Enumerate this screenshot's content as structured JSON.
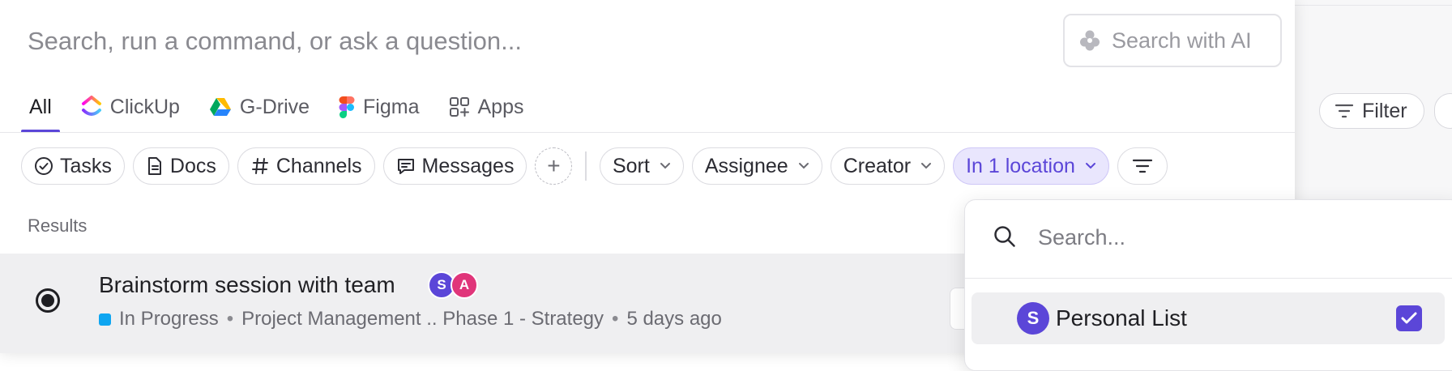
{
  "command_bar": {
    "placeholder": "Search, run a command, or ask a question...",
    "ai_button_label": "Search with AI"
  },
  "tabs": [
    {
      "label": "All",
      "active": true
    },
    {
      "label": "ClickUp",
      "icon": "clickup-logo-icon"
    },
    {
      "label": "G-Drive",
      "icon": "google-drive-icon"
    },
    {
      "label": "Figma",
      "icon": "figma-icon"
    },
    {
      "label": "Apps",
      "icon": "apps-grid-icon"
    }
  ],
  "filters": {
    "type_chips": [
      {
        "label": "Tasks",
        "icon": "check-circle-icon"
      },
      {
        "label": "Docs",
        "icon": "document-icon"
      },
      {
        "label": "Channels",
        "icon": "hash-icon"
      },
      {
        "label": "Messages",
        "icon": "message-icon"
      }
    ],
    "sort_label": "Sort",
    "assignee_label": "Assignee",
    "creator_label": "Creator",
    "location_label": "In 1 location"
  },
  "results": {
    "heading": "Results",
    "items": [
      {
        "title": "Brainstorm session with team",
        "assignees": [
          {
            "initial": "S",
            "color": "#5b46d8"
          },
          {
            "initial": "A",
            "color": "#e0357a"
          }
        ],
        "status": "In Progress",
        "status_color": "#0ea5f1",
        "location": "Project Management .. Phase 1 - Strategy",
        "updated": "5 days ago"
      }
    ]
  },
  "location_dropdown": {
    "search_placeholder": "Search...",
    "items": [
      {
        "initial": "S",
        "label": "Personal List",
        "checked": true
      }
    ]
  },
  "background": {
    "filter_label": "Filter"
  },
  "colors": {
    "accent": "#5b46d8",
    "active_chip_bg": "#e9e6fd"
  }
}
